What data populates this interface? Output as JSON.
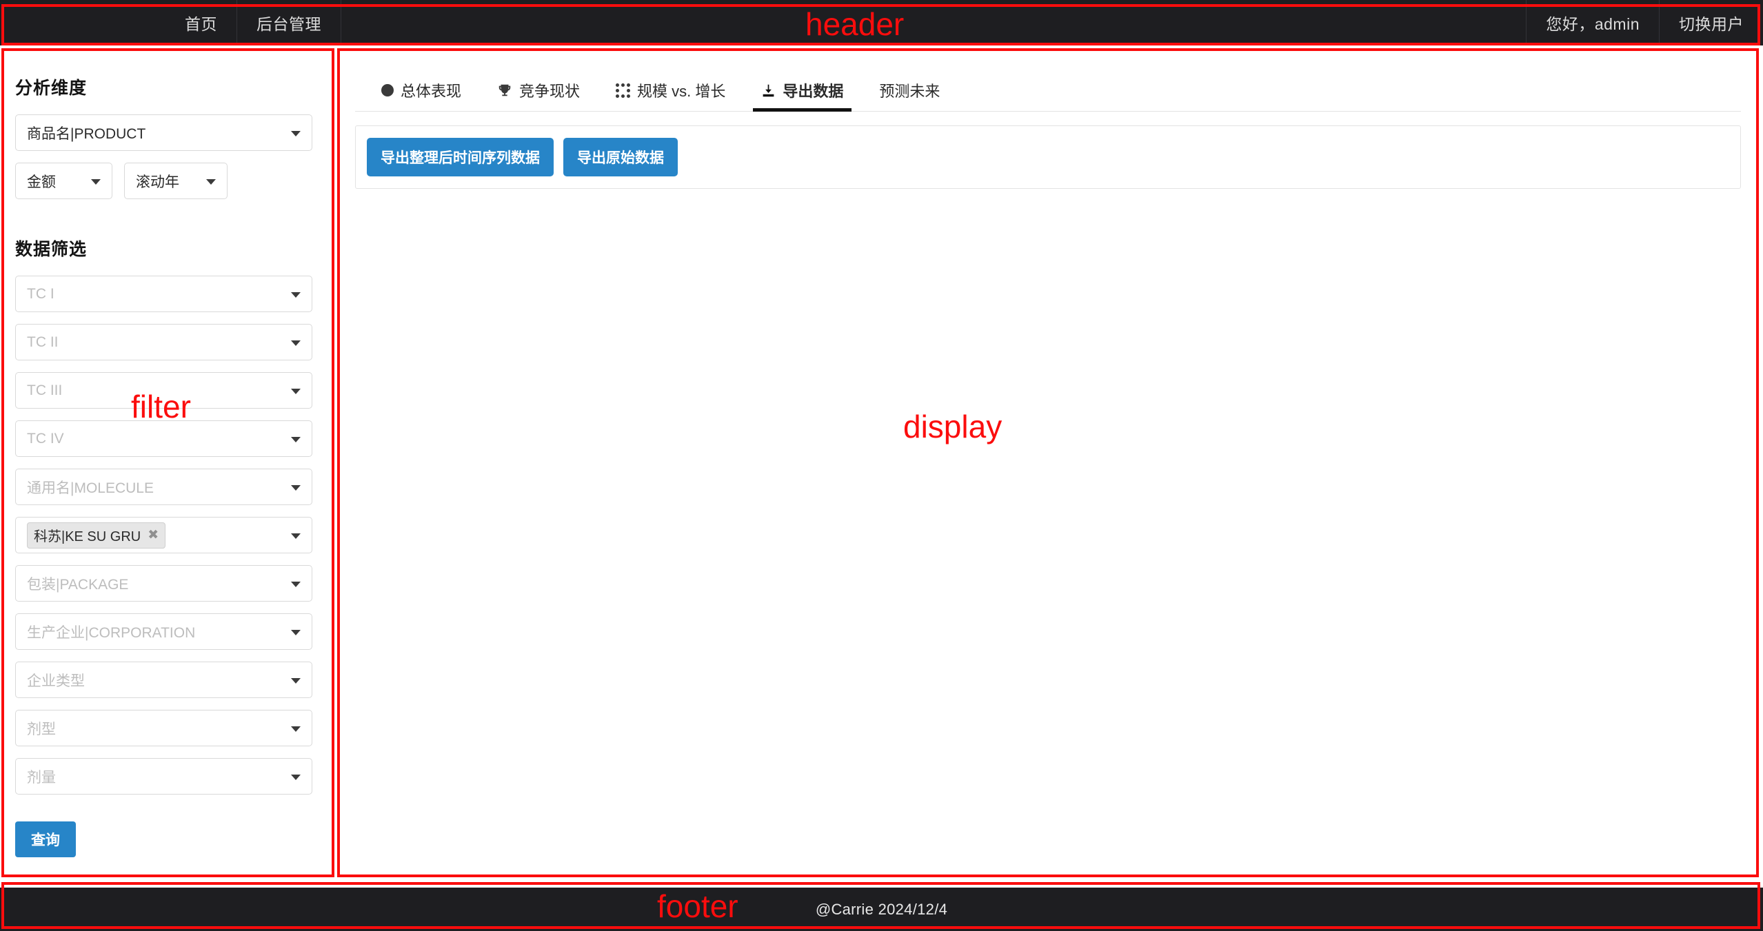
{
  "header": {
    "nav_items": [
      {
        "label": "首页"
      },
      {
        "label": "后台管理"
      }
    ],
    "user_greeting": "您好，admin",
    "switch_user": "切换用户"
  },
  "filter": {
    "dimension_title": "分析维度",
    "dimension_product": {
      "value": "商品名|PRODUCT"
    },
    "dimension_metric": {
      "value": "金额"
    },
    "dimension_period": {
      "value": "滚动年"
    },
    "data_filter_title": "数据筛选",
    "fields": [
      {
        "placeholder": "TC I",
        "value": ""
      },
      {
        "placeholder": "TC II",
        "value": ""
      },
      {
        "placeholder": "TC III",
        "value": ""
      },
      {
        "placeholder": "TC IV",
        "value": ""
      },
      {
        "placeholder": "通用名|MOLECULE",
        "value": ""
      },
      {
        "placeholder": "",
        "value": "",
        "tag": "科苏|KE SU GRU"
      },
      {
        "placeholder": "包装|PACKAGE",
        "value": ""
      },
      {
        "placeholder": "生产企业|CORPORATION",
        "value": ""
      },
      {
        "placeholder": "企业类型",
        "value": ""
      },
      {
        "placeholder": "剂型",
        "value": ""
      },
      {
        "placeholder": "剂量",
        "value": ""
      }
    ],
    "tag_remove_glyph": "✖",
    "query_button": "查询"
  },
  "display": {
    "tabs": [
      {
        "label": "总体表现",
        "icon": "filled-circle-icon",
        "active": false
      },
      {
        "label": "竞争现状",
        "icon": "trophy-icon",
        "active": false
      },
      {
        "label": "规模 vs. 增长",
        "icon": "scatter-dots-icon",
        "active": false
      },
      {
        "label": "导出数据",
        "icon": "download-icon",
        "active": true
      },
      {
        "label": "预测未来",
        "icon": "",
        "active": false
      }
    ],
    "export_buttons": [
      {
        "label": "导出整理后时间序列数据"
      },
      {
        "label": "导出原始数据"
      }
    ]
  },
  "footer": {
    "credit": "@Carrie 2024/12/4"
  },
  "annotations": {
    "header": "header",
    "filter": "filter",
    "display": "display",
    "footer": "footer",
    "color": "#fb0d0d"
  },
  "theme": {
    "navbar_bg": "#1e1e21",
    "primary_blue": "#2785c8",
    "active_tab_underline": "#111111"
  }
}
